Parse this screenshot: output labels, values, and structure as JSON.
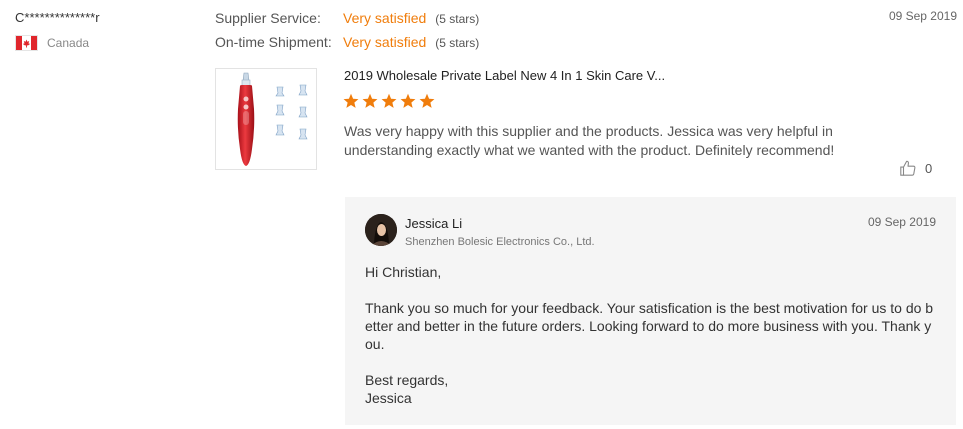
{
  "reviewer": {
    "name": "C**************r",
    "country": "Canada",
    "flag_colors": {
      "red": "#e0262c",
      "white": "#ffffff"
    }
  },
  "ratings": [
    {
      "label": "Supplier Service:",
      "value": "Very satisfied",
      "stars": "(5 stars)"
    },
    {
      "label": "On-time Shipment:",
      "value": "Very satisfied",
      "stars": "(5 stars)"
    }
  ],
  "review_date": "09 Sep 2019",
  "product": {
    "title": "2019 Wholesale Private Label New 4 In 1 Skin Care V...",
    "image_icon": "blackhead-remover-device-image"
  },
  "rating_stars": 5,
  "review_text": "Was very happy with this supplier and the products. Jessica was very helpful in understanding exactly what we wanted with the product. Definitely recommend!",
  "likes": {
    "count": "0",
    "icon": "thumbs-up-icon"
  },
  "reply": {
    "name": "Jessica Li",
    "company": "Shenzhen Bolesic Electronics Co., Ltd.",
    "date": "09 Sep 2019",
    "greeting": "Hi Christian,",
    "body": "Thank you so much for your feedback.  Your satisfication is the best motivation for us to do better and better in the future orders.  Looking forward to do more business with you. Thank you.",
    "closing": "Best regards,",
    "signature": "Jessica"
  },
  "colors": {
    "accent": "#f07d0c",
    "reply_background": "#f5f5f5"
  }
}
